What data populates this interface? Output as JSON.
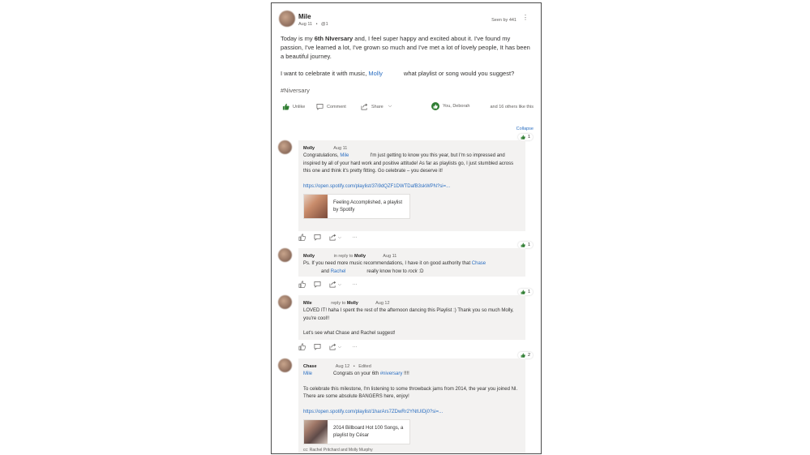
{
  "post": {
    "author": "Mile",
    "date": "Aug 11",
    "edit_marker": "@1",
    "seen": "Seen by 441",
    "paragraph1_pre": "Today is my ",
    "paragraph1_bold": "6th NIversary",
    "paragraph1_post": " and, I feel super happy and excited about it. I've found my passion, I've learned a lot, I've grown so much and I've met a lot of lovely people, It has been a beautiful journey.",
    "paragraph2_pre": "I want to celebrate it with music, ",
    "paragraph2_mention": "Molly",
    "paragraph2_post": "what playlist or song would you suggest?",
    "hashtag": "#Niversary",
    "actions": {
      "unlike": "Unlike",
      "comment": "Comment",
      "share": "Share"
    },
    "liked_by": "You, Deborah",
    "liked_others": "and 16 others like this"
  },
  "thread": {
    "collapse": "Collapse",
    "replies": [
      {
        "author": "Molly",
        "date": "Aug 11",
        "likes": "1",
        "text_pre": "Congratulations, ",
        "mention": "Mile",
        "text_post": "I'm just getting to know you this year, but I'm so impressed and inspired by all of your hard work and positive attitude! As far as playlists go, I just stumbled across this one and think it's pretty fitting. Go celebrate – you deserve it!",
        "link": "https://open.spotify.com/playlist/37i9dQZF1DWTDafB3skWPN?si=...",
        "preview": "Feeling Accomplished, a playlist by Spotify"
      },
      {
        "author": "Molly",
        "reply_to_label": "in reply to",
        "reply_to": "Molly",
        "date": "Aug 11",
        "likes": "1",
        "text_pre": "Ps. If you need more music recommendations, I have it on good authority that ",
        "mention1": "Chase",
        "mid": "and ",
        "mention2": "Rachel",
        "text_post": "really know how to ",
        "text_em": "rock",
        "text_end": " :D"
      },
      {
        "author": "Mile",
        "reply_to_label": "reply to",
        "reply_to": "Molly",
        "date": "Aug 12",
        "likes": "1",
        "text1": "LOVED IT! haha I spent the rest of the afternoon dancing this Playlist :) Thank you so much Molly, you're cool!!",
        "text2": "Let's see what Chase and Rachel suggest!"
      },
      {
        "author": "Chase",
        "date": "Aug 12",
        "edited": "Edited",
        "likes": "2",
        "mention": "Mile",
        "text_pre": "Congrats on your 6th ",
        "hashtag": "#niversary",
        "text_bang": " !!!!",
        "text2": "To celebrate this milestone, I'm listening to some throwback jams from 2014, the year you joined NI. There are some absolute BANGERS here, enjoy!",
        "link": "https://open.spotify.com/playlist/1harArs7ZDwRr2YNtUIDj0?si=...",
        "preview": "2014 Billboard Hot 100 Songs, a playlist by César",
        "cc": "cc: Rachel Pritchard and Molly Murphy"
      }
    ]
  },
  "colors": {
    "link": "#2a6ec1",
    "like_green": "#2f7d32",
    "bubble_bg": "#f3f2f1"
  }
}
